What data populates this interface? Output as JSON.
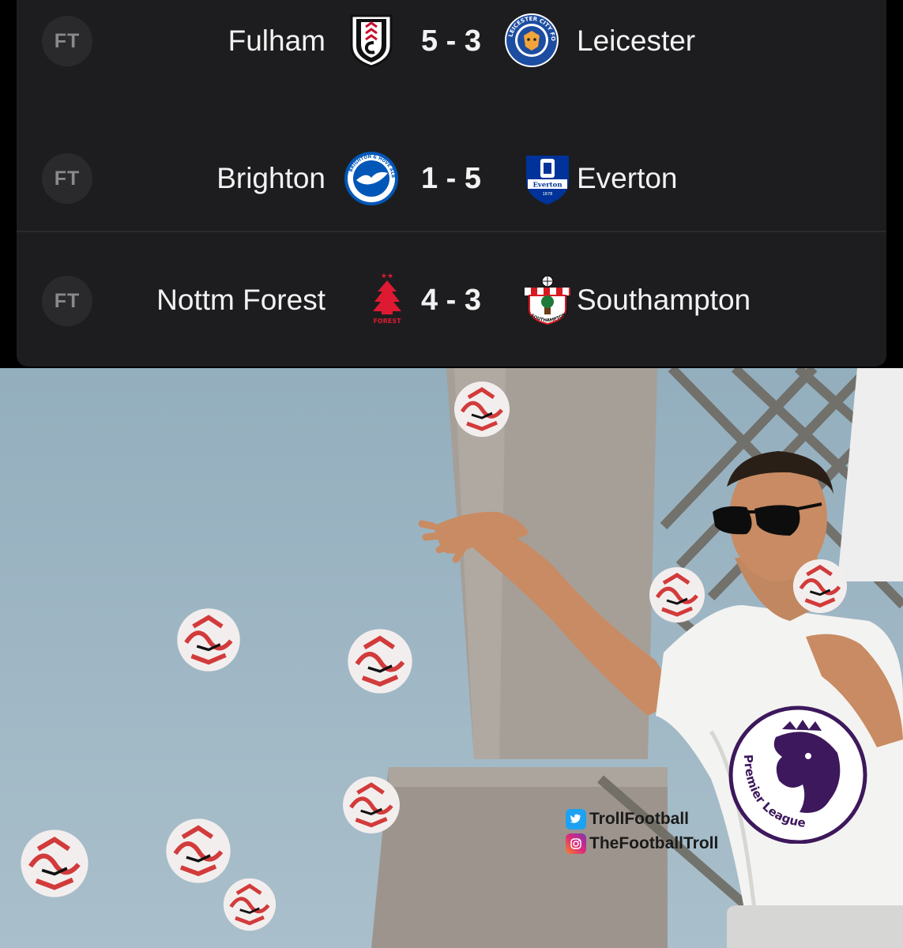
{
  "matches": [
    {
      "status": "FT",
      "home": "Fulham",
      "score": "5 - 3",
      "away": "Leicester",
      "home_crest": "fulham-crest",
      "away_crest": "leicester-crest"
    },
    {
      "status": "FT",
      "home": "Brighton",
      "score": "1 - 5",
      "away": "Everton",
      "home_crest": "brighton-crest",
      "away_crest": "everton-crest"
    },
    {
      "status": "FT",
      "home": "Nottm Forest",
      "score": "4 - 3",
      "away": "Southampton",
      "home_crest": "forest-crest",
      "away_crest": "southampton-crest"
    }
  ],
  "meme": {
    "watermark_twitter": "TrollFootball",
    "watermark_instagram": "TheFootballTroll",
    "badge_text": "Premier League"
  },
  "crest_text": {
    "leicester": "LEICESTER CITY FOOTBALL CLUB",
    "brighton": "BRIGHTON & HOVE ALBION",
    "everton": "Everton",
    "everton_year": "1878",
    "forest": "FOREST",
    "southampton": "SOUTHAMPTON F.C."
  },
  "colors": {
    "card_bg": "#1d1d1f",
    "text": "#f2f2f2",
    "badge_bg": "#2a2a2c",
    "badge_text": "#8a8a8e",
    "premier_league_purple": "#3d185c"
  }
}
